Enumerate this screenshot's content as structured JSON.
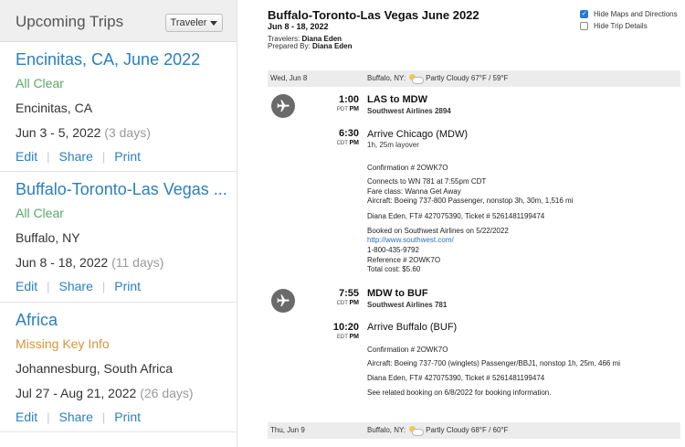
{
  "sidebar": {
    "title": "Upcoming Trips",
    "traveler_button": "Traveler",
    "trips": [
      {
        "name": "Encinitas, CA, June 2022",
        "status": "All Clear",
        "location": "Encinitas, CA",
        "dates": "Jun 3 - 5, 2022",
        "days": "(3 days)"
      },
      {
        "name": "Buffalo-Toronto-Las Vegas ...",
        "status": "All Clear",
        "location": "Buffalo, NY",
        "dates": "Jun 8 - 18, 2022",
        "days": "(11 days)"
      },
      {
        "name": "Africa",
        "status": "Missing Key Info",
        "location": "Johannesburg, South Africa",
        "dates": "Jul 27 - Aug 21, 2022",
        "days": "(26 days)"
      }
    ],
    "actions": {
      "edit": "Edit",
      "share": "Share",
      "print": "Print",
      "separator": "|"
    }
  },
  "itinerary": {
    "title": "Buffalo-Toronto-Las Vegas June 2022",
    "dates": "Jun 8 - 18, 2022",
    "travelers_label": "Travelers:",
    "travelers": "Diana Eden",
    "prepared_label": "Prepared By:",
    "prepared_by": "Diana Eden",
    "options": {
      "hide_maps": "Hide Maps and Directions",
      "hide_details": "Hide Trip Details"
    },
    "days": [
      {
        "label": "Wed, Jun 8",
        "location": "Buffalo, NY:",
        "weather": "Partly Cloudy 67°F / 59°F"
      },
      {
        "label": "Thu, Jun 9",
        "location": "Buffalo, NY:",
        "weather": "Partly Cloudy 68°F / 60°F"
      }
    ],
    "flight1": {
      "dep_time": "1:00",
      "dep_tz": "PDT",
      "dep_ampm": "PM",
      "route": "LAS to MDW",
      "airline": "Southwest Airlines 2894",
      "arr_time": "6:30",
      "arr_tz": "CDT",
      "arr_ampm": "PM",
      "arrive": "Arrive Chicago (MDW)",
      "layover": "1h, 25m layover",
      "confirmation": "Confirmation # 2OWK7O",
      "connects": "Connects to WN 781 at 7:55pm CDT",
      "fare": "Fare class: Wanna Get Away",
      "aircraft": "Aircraft: Boeing 737-800 Passenger, nonstop 3h, 30m, 1,516 mi",
      "passenger": "Diana Eden, FT# 427075390, Ticket # 5261481199474",
      "booked": "Booked on Southwest Airlines on 5/22/2022",
      "url": "http://www.southwest.com/",
      "phone": "1-800-435-9792",
      "reference": "Reference # 2OWK7O",
      "cost": "Total cost: $5.60"
    },
    "flight2": {
      "dep_time": "7:55",
      "dep_tz": "CDT",
      "dep_ampm": "PM",
      "route": "MDW to BUF",
      "airline": "Southwest Airlines 781",
      "arr_time": "10:20",
      "arr_tz": "EDT",
      "arr_ampm": "PM",
      "arrive": "Arrive Buffalo (BUF)",
      "confirmation": "Confirmation # 2OWK7O",
      "aircraft": "Aircraft: Boeing 737-700 (winglets) Passenger/BBJ1, nonstop 1h, 25m, 466 mi",
      "passenger": "Diana Eden, FT# 427075390, Ticket # 5261481199474",
      "related": "See related booking on 6/8/2022 for booking information."
    }
  }
}
